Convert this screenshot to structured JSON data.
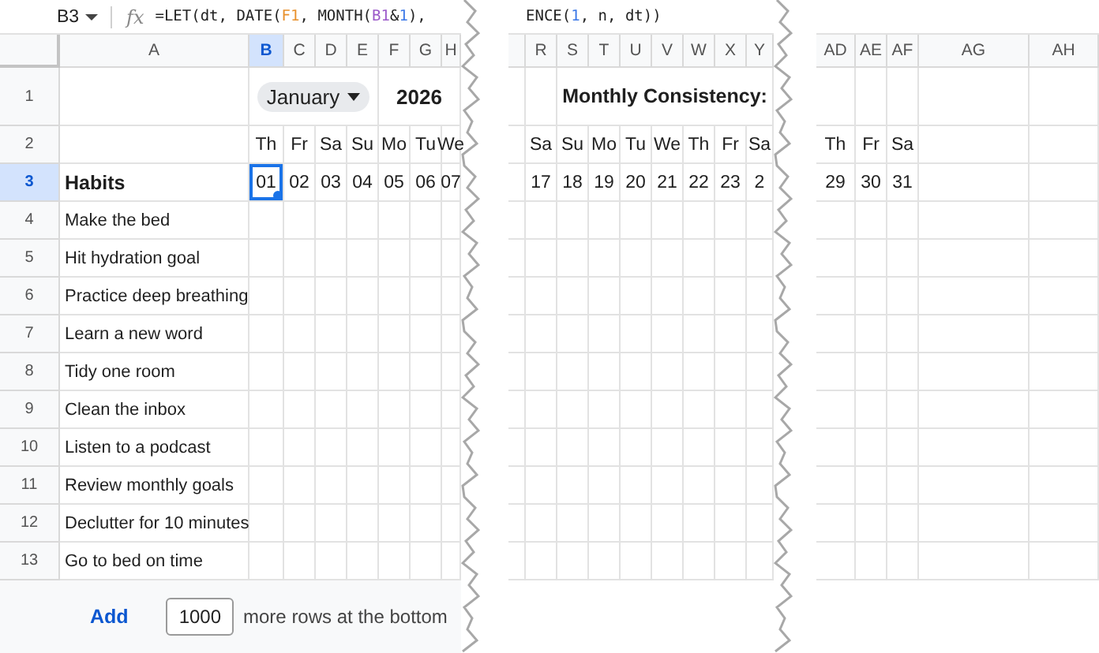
{
  "name_box": {
    "value": "B3"
  },
  "function_label": "fx",
  "panels": [
    {
      "formula": [
        {
          "text": "=LET(dt, DATE("
        },
        {
          "text": "F1",
          "color": "#e8912d"
        },
        {
          "text": ", MONTH("
        },
        {
          "text": "B1",
          "color": "#9b59c9"
        },
        {
          "text": "&"
        },
        {
          "text": "1",
          "color": "#3b78e7"
        },
        {
          "text": "),"
        }
      ],
      "columns": [
        {
          "label": "A",
          "selected": false
        },
        {
          "label": "B",
          "selected": true
        },
        {
          "label": "C",
          "selected": false
        },
        {
          "label": "D",
          "selected": false
        },
        {
          "label": "E",
          "selected": false
        },
        {
          "label": "F",
          "selected": false
        },
        {
          "label": "G",
          "selected": false
        },
        {
          "label": "H",
          "selected": false
        }
      ],
      "row_headers": [
        {
          "label": "1",
          "selected": false
        },
        {
          "label": "2",
          "selected": false
        },
        {
          "label": "3",
          "selected": true
        },
        {
          "label": "4",
          "selected": false
        },
        {
          "label": "5",
          "selected": false
        },
        {
          "label": "6",
          "selected": false
        },
        {
          "label": "7",
          "selected": false
        },
        {
          "label": "8",
          "selected": false
        },
        {
          "label": "9",
          "selected": false
        },
        {
          "label": "10",
          "selected": false
        },
        {
          "label": "11",
          "selected": false
        },
        {
          "label": "12",
          "selected": false
        },
        {
          "label": "13",
          "selected": false
        }
      ],
      "month_picker": {
        "value": "January"
      },
      "year": "2026",
      "weekdays": [
        "Th",
        "Fr",
        "Sa",
        "Su",
        "Mo",
        "Tu",
        "We"
      ],
      "dates": [
        {
          "label": "01",
          "selected": true
        },
        {
          "label": "02",
          "selected": false
        },
        {
          "label": "03",
          "selected": false
        },
        {
          "label": "04",
          "selected": false
        },
        {
          "label": "05",
          "selected": false
        },
        {
          "label": "06",
          "selected": false
        },
        {
          "label": "07",
          "selected": false
        }
      ],
      "habits_heading": "Habits",
      "habits": [
        "Make the bed",
        "Hit hydration goal",
        "Practice deep breathing",
        "Learn a new word",
        "Tidy one room",
        "Clean the inbox",
        "Listen to a podcast",
        "Review monthly goals",
        "Declutter for 10 minutes",
        "Go to bed on time"
      ],
      "footer": {
        "action": "Add",
        "row_count": "1000",
        "suffix": "more rows at the bottom"
      }
    },
    {
      "formula": [
        {
          "text": "ENCE("
        },
        {
          "text": "1",
          "color": "#3b78e7"
        },
        {
          "text": ", n, dt))"
        }
      ],
      "columns": [
        {
          "label": "R",
          "selected": false
        },
        {
          "label": "S",
          "selected": false
        },
        {
          "label": "T",
          "selected": false
        },
        {
          "label": "U",
          "selected": false
        },
        {
          "label": "V",
          "selected": false
        },
        {
          "label": "W",
          "selected": false
        },
        {
          "label": "X",
          "selected": false
        },
        {
          "label": "Y",
          "selected": false
        }
      ],
      "title": "Monthly Consistency:",
      "weekdays": [
        "Sa",
        "Su",
        "Mo",
        "Tu",
        "We",
        "Th",
        "Fr",
        "Sa"
      ],
      "dates": [
        {
          "label": "17",
          "selected": false
        },
        {
          "label": "18",
          "selected": false
        },
        {
          "label": "19",
          "selected": false
        },
        {
          "label": "20",
          "selected": false
        },
        {
          "label": "21",
          "selected": false
        },
        {
          "label": "22",
          "selected": false
        },
        {
          "label": "23",
          "selected": false
        },
        {
          "label": "2",
          "selected": false
        }
      ]
    },
    {
      "columns": [
        {
          "label": "AD",
          "selected": false
        },
        {
          "label": "AE",
          "selected": false
        },
        {
          "label": "AF",
          "selected": false
        },
        {
          "label": "AG",
          "selected": false
        },
        {
          "label": "AH",
          "selected": false
        }
      ],
      "weekdays": [
        "Th",
        "Fr",
        "Sa"
      ],
      "dates": [
        {
          "label": "29",
          "selected": false
        },
        {
          "label": "30",
          "selected": false
        },
        {
          "label": "31",
          "selected": false
        }
      ]
    }
  ]
}
